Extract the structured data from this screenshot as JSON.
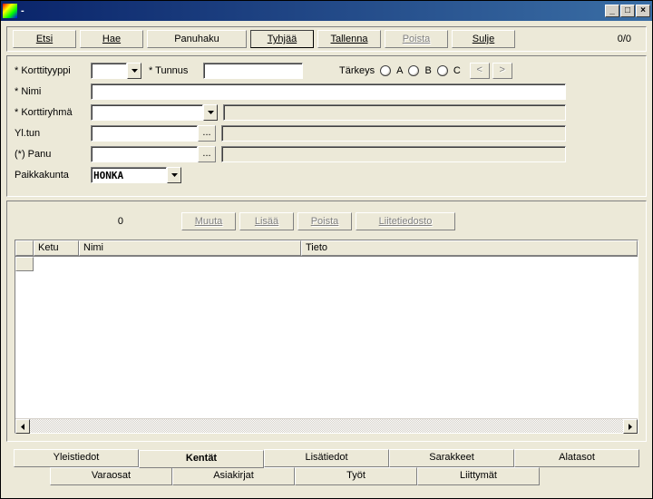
{
  "window": {
    "title": "-"
  },
  "toolbar": {
    "etsi": "Etsi",
    "hae": "Hae",
    "panuhaku": "Panuhaku",
    "tyhjaa": "Tyhjää",
    "tallenna": "Tallenna",
    "poista": "Poista",
    "sulje": "Sulje",
    "counter": "0/0"
  },
  "form": {
    "korttityyppi_label": "* Korttityyppi",
    "korttityyppi_value": "",
    "tunnus_label": "* Tunnus",
    "tunnus_value": "",
    "tarkeys_label": "Tärkeys",
    "opt_a": "A",
    "opt_b": "B",
    "opt_c": "C",
    "nav_prev": "<",
    "nav_next": ">",
    "nimi_label": "* Nimi",
    "nimi_value": "",
    "korttiryhma_label": "* Korttiryhmä",
    "korttiryhma_value": "",
    "yltun_label": "Yl.tun",
    "yltun_value": "",
    "panu_label": "(*) Panu",
    "panu_value": "",
    "paikkakunta_label": "Paikkakunta",
    "paikkakunta_value": "HONKA",
    "ellipsis": "..."
  },
  "sub": {
    "count": "0",
    "muuta": "Muuta",
    "lisaa": "Lisää",
    "poista": "Poista",
    "liitetiedosto": "Liitetiedosto"
  },
  "grid": {
    "col1": "Ketu",
    "col2": "Nimi",
    "col3": "Tieto"
  },
  "tabs_top": {
    "yleistiedot": "Yleistiedot",
    "kentat": "Kentät",
    "lisatiedot": "Lisätiedot",
    "sarakkeet": "Sarakkeet",
    "alatasot": "Alatasot"
  },
  "tabs_bottom": {
    "varaosat": "Varaosat",
    "asiakirjat": "Asiakirjat",
    "tyot": "Työt",
    "liittymat": "Liittymät"
  }
}
